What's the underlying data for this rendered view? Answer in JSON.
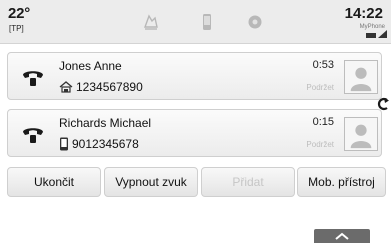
{
  "status": {
    "temperature": "22°",
    "traffic_program": "[TP]",
    "time": "14:22",
    "phone_name": "MyPhone",
    "tabs": [
      {
        "icon": "media-tab-icon"
      },
      {
        "icon": "phone-tab-icon"
      },
      {
        "icon": "app-tab-icon"
      }
    ]
  },
  "calls": [
    {
      "name": "Jones Anne",
      "number_icon": "home-phone-icon",
      "number": "1234567890",
      "duration": "0:53",
      "hold_label": "Podržet"
    },
    {
      "name": "Richards Michael",
      "number_icon": "mobile-phone-icon",
      "number": "9012345678",
      "duration": "0:15",
      "hold_label": "Podržet"
    }
  ],
  "actions": {
    "end": "Ukončit",
    "mute": "Vypnout zvuk",
    "add": "Přidat",
    "mobile": "Mob. přístroj"
  },
  "colors": {
    "status_bg": "#ececec",
    "card_bg": "#f4f4f4",
    "disabled_text": "#c6c6c6",
    "collapse_tab": "#6b6b6b"
  }
}
